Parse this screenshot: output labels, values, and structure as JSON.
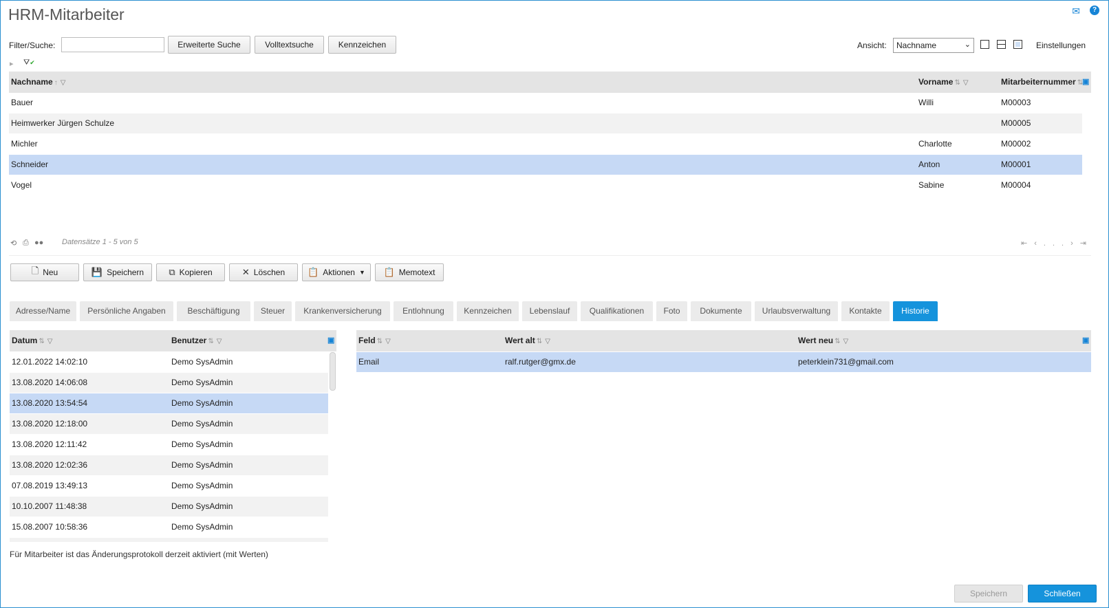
{
  "window": {
    "title": "HRM-Mitarbeiter"
  },
  "icons": {
    "mail": "mail-icon",
    "help": "help-icon"
  },
  "toolbar": {
    "filter_label": "Filter/Suche:",
    "filter_value": "",
    "advanced_search": "Erweiterte Suche",
    "fulltext_search": "Volltextsuche",
    "tags": "Kennzeichen",
    "view_label": "Ansicht:",
    "view_selected": "Nachname",
    "settings": "Einstellungen"
  },
  "employees": {
    "columns": [
      "Nachname",
      "Vorname",
      "Mitarbeiternummer"
    ],
    "rows": [
      {
        "nachname": "Bauer",
        "vorname": "Willi",
        "nummer": "M00003"
      },
      {
        "nachname": "Heimwerker Jürgen Schulze",
        "vorname": "",
        "nummer": "M00005"
      },
      {
        "nachname": "Michler",
        "vorname": "Charlotte",
        "nummer": "M00002"
      },
      {
        "nachname": "Schneider",
        "vorname": "Anton",
        "nummer": "M00001"
      },
      {
        "nachname": "Vogel",
        "vorname": "Sabine",
        "nummer": "M00004"
      }
    ],
    "selected_index": 3,
    "record_info": "Datensätze 1 - 5 von 5",
    "pager_ellipsis": "..."
  },
  "actions": {
    "new": "Neu",
    "save": "Speichern",
    "copy": "Kopieren",
    "delete": "Löschen",
    "actions": "Aktionen",
    "memo": "Memotext"
  },
  "tabs": [
    "Adresse/Name",
    "Persönliche Angaben",
    "Beschäftigung",
    "Steuer",
    "Krankenversicherung",
    "Entlohnung",
    "Kennzeichen",
    "Lebenslauf",
    "Qualifikationen",
    "Foto",
    "Dokumente",
    "Urlaubsverwaltung",
    "Kontakte",
    "Historie"
  ],
  "active_tab": "Historie",
  "history": {
    "columns": [
      "Datum",
      "Benutzer"
    ],
    "rows": [
      {
        "datum": "12.01.2022 14:02:10",
        "benutzer": "Demo SysAdmin"
      },
      {
        "datum": "13.08.2020 14:06:08",
        "benutzer": "Demo SysAdmin"
      },
      {
        "datum": "13.08.2020 13:54:54",
        "benutzer": "Demo SysAdmin"
      },
      {
        "datum": "13.08.2020 12:18:00",
        "benutzer": "Demo SysAdmin"
      },
      {
        "datum": "13.08.2020 12:11:42",
        "benutzer": "Demo SysAdmin"
      },
      {
        "datum": "13.08.2020 12:02:36",
        "benutzer": "Demo SysAdmin"
      },
      {
        "datum": "07.08.2019 13:49:13",
        "benutzer": "Demo SysAdmin"
      },
      {
        "datum": "10.10.2007 11:48:38",
        "benutzer": "Demo SysAdmin"
      },
      {
        "datum": "15.08.2007 10:58:36",
        "benutzer": "Demo SysAdmin"
      }
    ],
    "selected_index": 2
  },
  "changes": {
    "columns": [
      "Feld",
      "Wert alt",
      "Wert neu"
    ],
    "rows": [
      {
        "feld": "Email",
        "alt": "ralf.rutger@gmx.de",
        "neu": "peterklein731@gmail.com"
      }
    ]
  },
  "footer": {
    "status": "Für Mitarbeiter ist das Änderungsprotokoll derzeit aktiviert (mit Werten)",
    "save": "Speichern",
    "close": "Schließen"
  }
}
